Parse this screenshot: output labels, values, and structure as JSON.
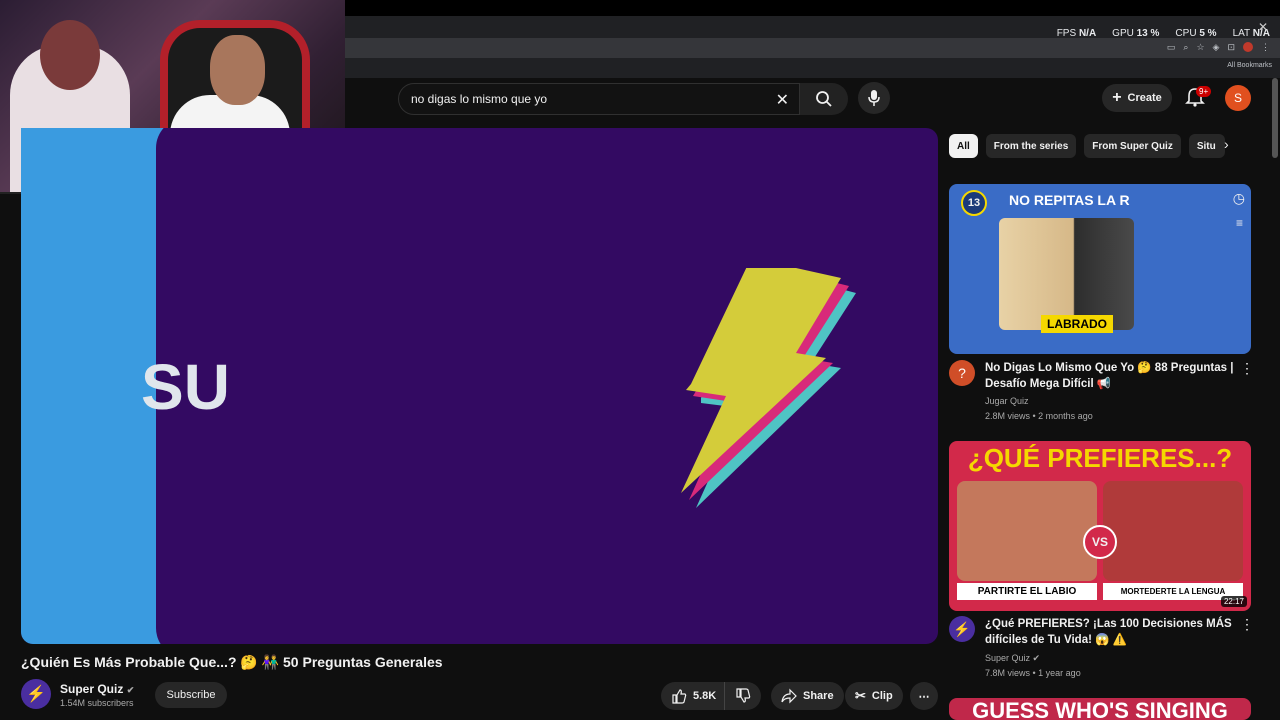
{
  "browser": {
    "perf": [
      {
        "label": "FPS",
        "value": "N/A"
      },
      {
        "label": "GPU",
        "value": "13 %"
      },
      {
        "label": "CPU",
        "value": "5 %"
      },
      {
        "label": "LAT",
        "value": "N/A"
      }
    ],
    "bookmarks_label": "All Bookmarks"
  },
  "search": {
    "query": "no digas lo mismo que yo"
  },
  "masthead": {
    "create_label": "Create",
    "notif_count": "9+",
    "avatar_letter": "S"
  },
  "player": {
    "logo_text": "SU"
  },
  "video": {
    "title": "¿Quién Es Más Probable Que...? 🤔 👫 50 Preguntas Generales",
    "channel": "Super Quiz",
    "subscribers": "1.54M subscribers",
    "subscribe_label": "Subscribe",
    "likes": "5.8K",
    "share_label": "Share",
    "clip_label": "Clip"
  },
  "chips": [
    "All",
    "From the series",
    "From Super Quiz",
    "Situ"
  ],
  "recommendations": [
    {
      "thumb_text": "NO REPITAS LA R",
      "thumb_badge": "13",
      "thumb_caption": "LABRADO",
      "title": "No Digas Lo Mismo Que Yo 🤔 88 Preguntas | Desafío Mega Difícil 📢",
      "channel": "Jugar Quiz",
      "meta": "2.8M views • 2 months ago"
    },
    {
      "thumb_text": "¿QUÉ PREFIERES...?",
      "thumb_left_caption": "PARTIRTE EL LABIO",
      "thumb_right_caption": "MORTEDERTE LA LENGUA",
      "thumb_vs": "VS",
      "duration": "22:17",
      "title": "¿Qué PREFIERES? ¡Las 100 Decisiones MÁS difíciles de Tu Vida! 😱 ⚠️",
      "channel": "Super Quiz",
      "meta": "7.8M views • 1 year ago"
    },
    {
      "thumb_text": "GUESS WHO'S SINGING"
    }
  ],
  "colors": {
    "accent_red": "#cc0000",
    "player_bg": "#330a62",
    "player_blue": "#3a9be0",
    "bolt_yellow": "#d4cc3a",
    "bolt_pink": "#d82a7a",
    "bolt_teal": "#4fc4c4"
  }
}
